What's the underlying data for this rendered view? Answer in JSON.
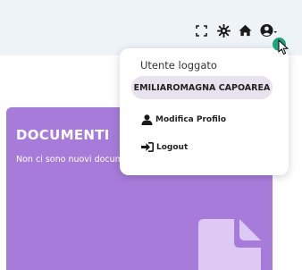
{
  "header": {
    "icons": [
      "fullscreen-icon",
      "settings-icon",
      "home-icon",
      "user-icon"
    ]
  },
  "card": {
    "title": "DOCUMENTI",
    "subtitle": "Non ci sono nuovi documenti",
    "color": "#a77bd9",
    "icon": "document-icon"
  },
  "user_menu": {
    "label": "Utente loggato",
    "username": "EMILIAROMAGNA CAPOAREA",
    "items": [
      {
        "label": "Modifica Profilo",
        "icon": "user-icon"
      },
      {
        "label": "Logout",
        "icon": "logout-icon"
      }
    ]
  },
  "colors": {
    "topbar_bg": "#eef3f8",
    "accent": "#1fa37b",
    "card_purple": "#a77bd9"
  }
}
